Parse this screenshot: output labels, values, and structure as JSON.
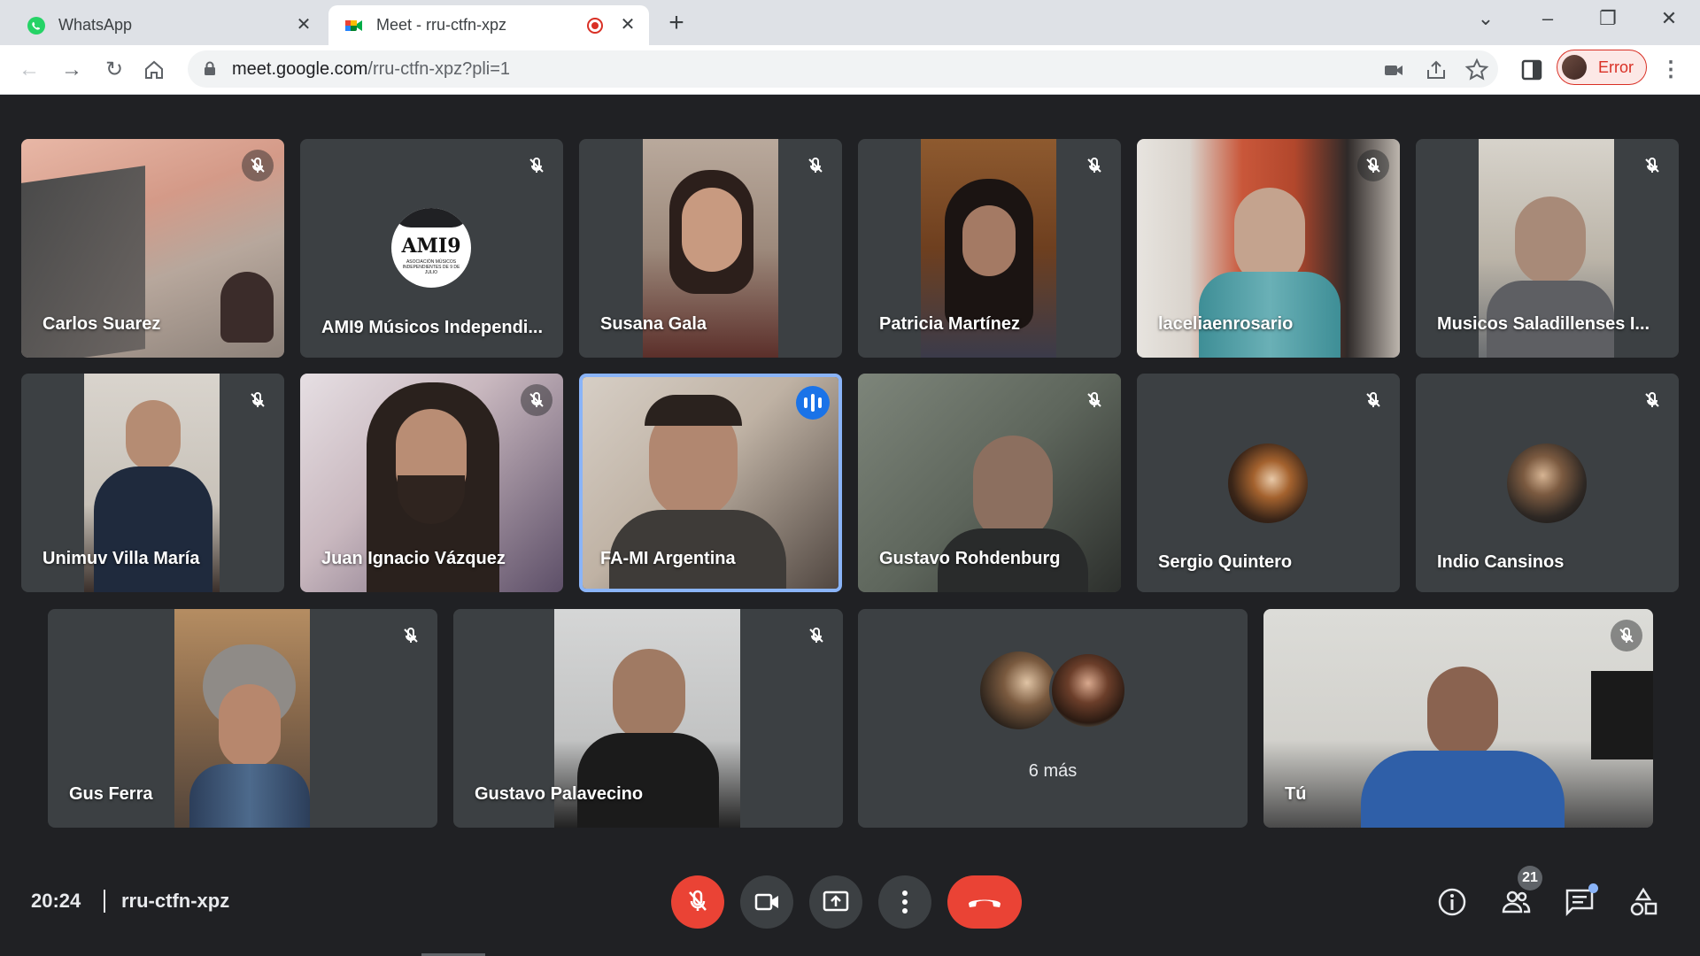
{
  "browser": {
    "tabs": [
      {
        "title": "WhatsApp",
        "active": false
      },
      {
        "title": "Meet - rru-ctfn-xpz",
        "active": true,
        "recording": true
      }
    ],
    "address_bar": {
      "domain": "meet.google.com",
      "path": "/rru-ctfn-xpz?pli=1"
    },
    "profile_label": "Error"
  },
  "meeting": {
    "time": "20:24",
    "code": "rru-ctfn-xpz",
    "participant_count": "21",
    "more_label": "6 más",
    "participants": [
      {
        "name": "Carlos Suarez",
        "muted": true
      },
      {
        "name": "AMI9 Músicos Independi...",
        "muted": true
      },
      {
        "name": "Susana Gala",
        "muted": true
      },
      {
        "name": "Patricia Martínez",
        "muted": true
      },
      {
        "name": "laceliaenrosario",
        "muted": true
      },
      {
        "name": "Musicos Saladillenses I...",
        "muted": true
      },
      {
        "name": "Unimuv Villa María",
        "muted": true
      },
      {
        "name": "Juan Ignacio Vázquez",
        "muted": true
      },
      {
        "name": "FA-MI Argentina",
        "muted": false,
        "speaking": true
      },
      {
        "name": "Gustavo Rohdenburg",
        "muted": true
      },
      {
        "name": "Sergio Quintero",
        "muted": true
      },
      {
        "name": "Indio Cansinos",
        "muted": true
      },
      {
        "name": "Gus Ferra",
        "muted": true
      },
      {
        "name": "Gustavo Palavecino",
        "muted": true
      },
      {
        "name": "Tú",
        "muted": true
      }
    ],
    "logo_text": {
      "main": "AMI9",
      "sub": "ASOCIACIÓN MÚSICOS INDEPENDIENTES DE 9 DE JULIO"
    }
  },
  "colors": {
    "speaking_border": "#8ab4f8",
    "end_call": "#ea4335",
    "mic_off": "#ea4335",
    "bg": "#202124",
    "tile": "#3c4043"
  }
}
